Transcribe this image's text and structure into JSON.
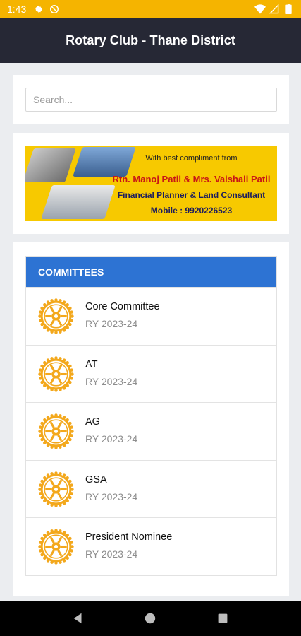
{
  "status_bar": {
    "time": "1:43",
    "icons": [
      "gear-icon",
      "no-disturb-icon",
      "wifi-icon",
      "signal-icon",
      "battery-icon"
    ]
  },
  "app_bar": {
    "title": "Rotary Club - Thane District"
  },
  "search": {
    "placeholder": "Search..."
  },
  "banner": {
    "line1": "With best compliment from",
    "line2": "Rtn. Manoj Patil & Mrs. Vaishali Patil",
    "line3": "Financial Planner & Land Consultant",
    "line4": "Mobile : 9920226523"
  },
  "committees": {
    "header": "COMMITTEES",
    "items": [
      {
        "name": "Core Committee",
        "year": "RY 2023-24"
      },
      {
        "name": "AT",
        "year": "RY 2023-24"
      },
      {
        "name": "AG",
        "year": "RY 2023-24"
      },
      {
        "name": "GSA",
        "year": "RY 2023-24"
      },
      {
        "name": "President Nominee",
        "year": "RY 2023-24"
      }
    ]
  },
  "colors": {
    "status_bar": "#f5b400",
    "app_bar": "#262835",
    "committee_header": "#2d73d3",
    "rotary_gold": "#f3a81c"
  }
}
